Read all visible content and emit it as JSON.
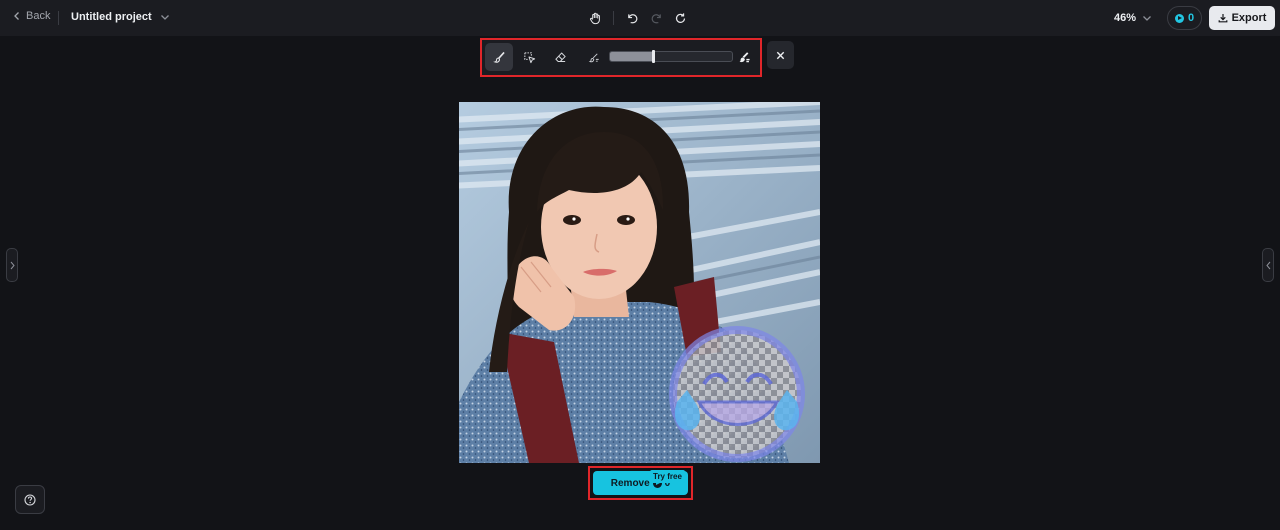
{
  "header": {
    "back_label": "Back",
    "project_title": "Untitled project",
    "zoom_label": "46%",
    "credits_count": "0",
    "export_label": "Export"
  },
  "toolbar": {
    "icons": [
      "hand-icon",
      "undo-icon",
      "redo-icon",
      "refresh-icon"
    ],
    "redo_enabled": false
  },
  "brush_tools": {
    "active_tool": "brush",
    "brush_size_fraction": 0.35
  },
  "canvas": {
    "image_description": "photo of a young woman with dark hair and bangs, denim jacket, metal railings background, with a crying-laughing emoji mask overlay"
  },
  "actions": {
    "remove_label": "Remove",
    "remove_cost": "0",
    "try_free_badge": "Try free"
  },
  "colors": {
    "accent": "#17c3e0",
    "highlight": "#e0262a",
    "background": "#121317"
  }
}
